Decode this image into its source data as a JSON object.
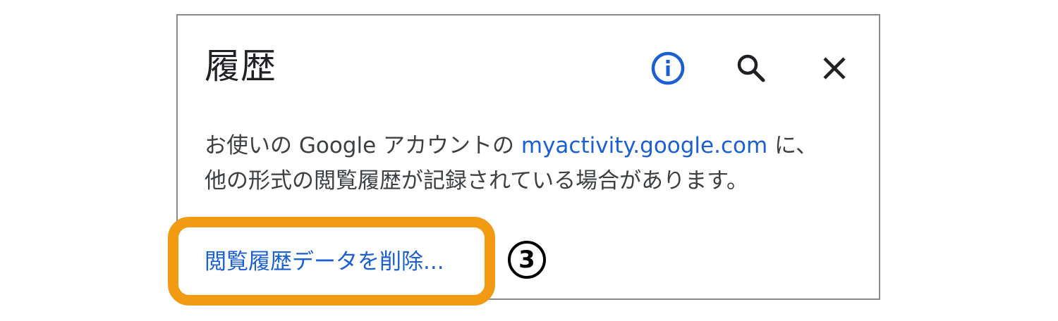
{
  "dialog": {
    "title": "履歴",
    "info_icon": "info-icon",
    "search_icon": "search-icon",
    "close_icon": "close-icon",
    "description_part1": "お使いの Google アカウントの ",
    "description_link": "myactivity.google.com",
    "description_part2": " に、",
    "description_line2": "他の形式の閲覧履歴が記録されている場合があります。",
    "delete_link": "閲覧履歴データを削除..."
  },
  "annotation": {
    "step_number": "3",
    "highlight_color": "#f29a12"
  },
  "colors": {
    "link": "#1a5fd4",
    "info_icon": "#1a5fd4",
    "text": "#3c4043",
    "title": "#202124"
  }
}
